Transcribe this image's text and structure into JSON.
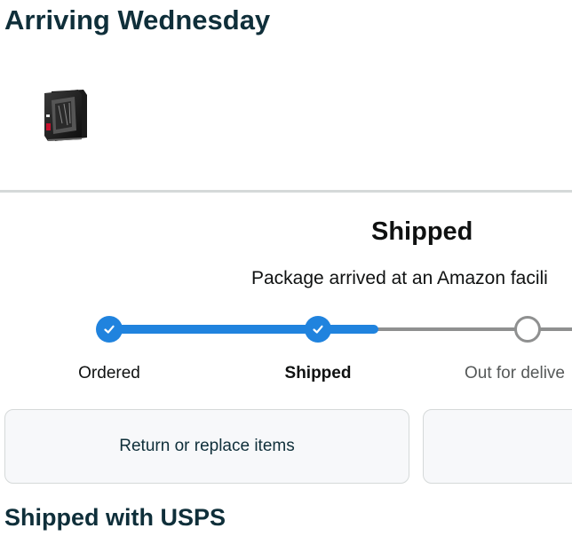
{
  "delivery": {
    "title": "Arriving Wednesday"
  },
  "item": {
    "thumbnail_icon": "graphics-card-box-image"
  },
  "status": {
    "heading": "Shipped",
    "detail": "Package arrived at an Amazon facili"
  },
  "progress": {
    "steps": [
      {
        "label": "Ordered",
        "state": "complete"
      },
      {
        "label": "Shipped",
        "state": "current"
      },
      {
        "label": "Out for delive",
        "state": "pending"
      }
    ],
    "colors": {
      "complete": "#2083de",
      "pending": "#8f9090"
    }
  },
  "actions": {
    "return_replace": "Return or replace items",
    "second_button": ""
  },
  "carrier": {
    "title": "Shipped with USPS"
  }
}
